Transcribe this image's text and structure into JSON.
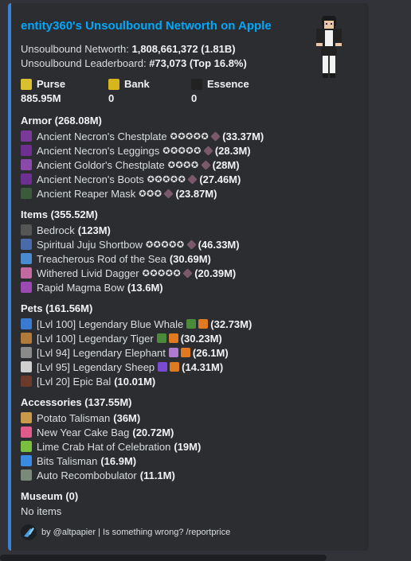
{
  "title": "entity360's Unsoulbound Networth on Apple",
  "unsoulbound_networth_label": "Unsoulbound Networth:",
  "unsoulbound_networth_value": "1,808,661,372",
  "unsoulbound_networth_short": "(1.81B)",
  "leaderboard_label": "Unsoulbound Leaderboard:",
  "leaderboard_value": "#73,073",
  "leaderboard_top": "(Top 16.8%)",
  "stats": [
    {
      "label": "Purse",
      "value": "885.95M",
      "icon": "gold-ingot-icon",
      "color": "#d9c030"
    },
    {
      "label": "Bank",
      "value": "0",
      "icon": "gold-block-icon",
      "color": "#d6b51d"
    },
    {
      "label": "Essence",
      "value": "0",
      "icon": "wither-skull-icon",
      "color": "#222222"
    }
  ],
  "sections": [
    {
      "title": "Armor (268.08M)",
      "items": [
        {
          "icon": "chestplate-icon",
          "color": "#7a3a9a",
          "name": "Ancient Necron's Chestplate",
          "stars": "✪✪✪✪✪",
          "gem": true,
          "value": "(33.37M)"
        },
        {
          "icon": "leggings-icon",
          "color": "#6e3090",
          "name": "Ancient Necron's Leggings",
          "stars": "✪✪✪✪✪",
          "gem": true,
          "value": "(28.3M)"
        },
        {
          "icon": "chestplate-icon",
          "color": "#8a4aa8",
          "name": "Ancient Goldor's Chestplate",
          "stars": "✪✪✪✪",
          "gem": true,
          "value": "(28M)"
        },
        {
          "icon": "boots-icon",
          "color": "#6e3090",
          "name": "Ancient Necron's Boots",
          "stars": "✪✪✪✪✪",
          "gem": true,
          "value": "(27.46M)"
        },
        {
          "icon": "reaper-mask-icon",
          "color": "#3a5a3a",
          "name": "Ancient Reaper Mask",
          "stars": "✪✪✪",
          "gem": true,
          "value": "(23.87M)"
        }
      ]
    },
    {
      "title": "Items (355.52M)",
      "items": [
        {
          "icon": "bedrock-icon",
          "color": "#555555",
          "name": "Bedrock",
          "stars": "",
          "gem": false,
          "value": "(123M)",
          "plain": true
        },
        {
          "icon": "bow-icon",
          "color": "#4a6aa8",
          "name": "Spiritual Juju Shortbow",
          "stars": "✪✪✪✪✪",
          "gem": true,
          "value": "(46.33M)"
        },
        {
          "icon": "fishing-rod-icon",
          "color": "#4a8ad0",
          "name": "Treacherous Rod of the Sea",
          "stars": "",
          "gem": false,
          "value": "(30.69M)",
          "plain": true
        },
        {
          "icon": "dagger-icon",
          "color": "#c06aa0",
          "name": "Withered Livid Dagger",
          "stars": "✪✪✪✪✪",
          "gem": true,
          "value": "(20.39M)"
        },
        {
          "icon": "bow-icon",
          "color": "#9a4ab0",
          "name": "Rapid Magma Bow",
          "stars": "",
          "gem": false,
          "value": "(13.6M)",
          "plain": true
        }
      ]
    },
    {
      "title": "Pets (161.56M)",
      "items": [
        {
          "icon": "blue-whale-icon",
          "color": "#3a7ad0",
          "name": "[Lvl 100] Legendary Blue Whale",
          "stars": "",
          "gem": false,
          "value": "(32.73M)",
          "pet": true,
          "extra": [
            "#4a8a3a",
            "#e07a20"
          ]
        },
        {
          "icon": "tiger-icon",
          "color": "#b07a3a",
          "name": "[Lvl 100] Legendary Tiger",
          "stars": "",
          "gem": false,
          "value": "(30.23M)",
          "pet": true,
          "extra": [
            "#4a8a3a",
            "#e07a20"
          ]
        },
        {
          "icon": "elephant-icon",
          "color": "#8a8a8a",
          "name": "[Lvl 94] Legendary Elephant",
          "stars": "",
          "gem": false,
          "value": "(26.1M)",
          "pet": true,
          "extra": [
            "#b07ad0",
            "#e07a20"
          ]
        },
        {
          "icon": "sheep-icon",
          "color": "#d0d0d0",
          "name": "[Lvl 95] Legendary Sheep",
          "stars": "",
          "gem": false,
          "value": "(14.31M)",
          "pet": true,
          "extra": [
            "#7a4ad0",
            "#e07a20"
          ]
        },
        {
          "icon": "bal-icon",
          "color": "#6a3a2a",
          "name": "[Lvl 20] Epic Bal",
          "stars": "",
          "gem": false,
          "value": "(10.01M)",
          "pet": true,
          "extra": []
        }
      ]
    },
    {
      "title": "Accessories (137.55M)",
      "items": [
        {
          "icon": "potato-talisman-icon",
          "color": "#c89a4a",
          "name": "Potato Talisman",
          "stars": "",
          "gem": false,
          "value": "(36M)",
          "plain": true
        },
        {
          "icon": "cake-bag-icon",
          "color": "#e05a8a",
          "name": "New Year Cake Bag",
          "stars": "",
          "gem": false,
          "value": "(20.72M)",
          "plain": true
        },
        {
          "icon": "crab-hat-icon",
          "color": "#7ac040",
          "name": "Lime Crab Hat of Celebration",
          "stars": "",
          "gem": false,
          "value": "(19M)",
          "plain": true
        },
        {
          "icon": "bits-talisman-icon",
          "color": "#3a8ae0",
          "name": "Bits Talisman",
          "stars": "",
          "gem": false,
          "value": "(16.9M)",
          "plain": true
        },
        {
          "icon": "recombobulator-icon",
          "color": "#7a8a7a",
          "name": "Auto Recombobulator",
          "stars": "",
          "gem": false,
          "value": "(11.1M)",
          "plain": true
        }
      ]
    }
  ],
  "museum_title": "Museum (0)",
  "museum_empty": "No items",
  "footer_text": "by @altpapier | Is something wrong? /reportprice"
}
